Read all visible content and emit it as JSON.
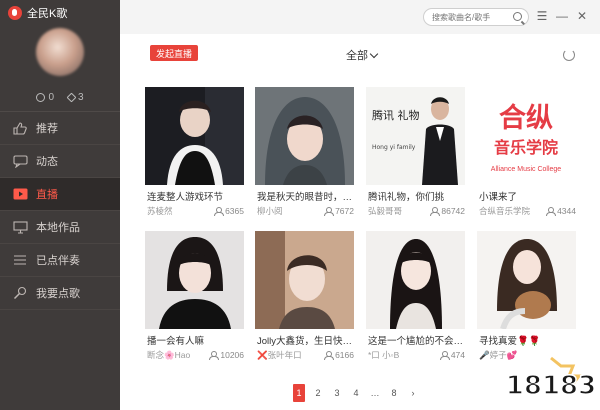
{
  "app": {
    "title": "全民K歌"
  },
  "profile": {
    "stat_a": "0",
    "stat_b": "3"
  },
  "sidebar": {
    "items": [
      {
        "label": "推荐",
        "icon": "thumbs-up-icon"
      },
      {
        "label": "动态",
        "icon": "chat-icon"
      },
      {
        "label": "直播",
        "icon": "video-play-icon",
        "active": true
      },
      {
        "label": "本地作品",
        "icon": "monitor-icon"
      },
      {
        "label": "已点伴奏",
        "icon": "list-icon"
      },
      {
        "label": "我要点歌",
        "icon": "mic-icon"
      }
    ]
  },
  "topbar": {
    "search_placeholder": "搜索歌曲名/歌手",
    "menu": "☰",
    "minimize": "—",
    "close": "✕"
  },
  "main": {
    "live_button": "发起直播",
    "filter": "全部"
  },
  "cards": [
    {
      "title": "连麦整人游戏环节",
      "host": "苏棱然",
      "count": "6365"
    },
    {
      "title": "我是秋天的眼昔时，…",
      "host": "柳小阅",
      "count": "7672"
    },
    {
      "title": "腾讯礼物，你们挑",
      "host": "弘毅哥哥",
      "count": "86742"
    },
    {
      "title": "小课来了",
      "host": "合纵音乐学院",
      "count": "4344"
    },
    {
      "title": "播一会有人嘛",
      "host": "断念🌸Hao",
      "count": "10206"
    },
    {
      "title": "Jolly大鑫货，生日快…",
      "host": "❌张叶年口",
      "count": "6166"
    },
    {
      "title": "这是一个尴尬的不会…",
      "host": "*口 小◦B",
      "count": "474"
    },
    {
      "title": "寻找真爱🌹🌹",
      "host": "🎤婷子💕",
      "count": ""
    }
  ],
  "pagination": {
    "pages": [
      "1",
      "2",
      "3",
      "4",
      "…",
      "8",
      "›"
    ],
    "current": "1"
  },
  "brand_tile": {
    "cn_big": "合纵",
    "cn_small": "音乐学院",
    "en": "Alliance Music College"
  },
  "poster": {
    "line1": "腾讯 礼物",
    "line2": "Hong yi family"
  },
  "watermark": {
    "text": "18183"
  },
  "colors": {
    "accent": "#e8433a",
    "sidebar_bg": "#3f3b3a",
    "active_bg": "#2f2b2a"
  }
}
